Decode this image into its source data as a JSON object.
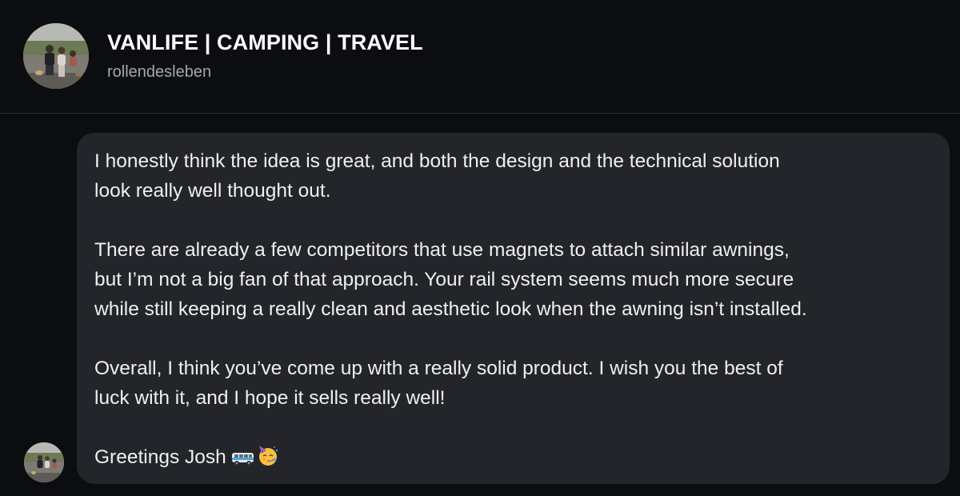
{
  "header": {
    "title": "VANLIFE | CAMPING | TRAVEL",
    "username": "rollendesleben"
  },
  "message": {
    "paragraphs": [
      [
        "I honestly think the idea is great, and both the design and the technical solution",
        "look really well thought out."
      ],
      [
        "There are already a few competitors that use magnets to attach similar awnings,",
        "but I’m not a big fan of that approach. Your rail system seems much more secure",
        "while still keeping a really clean and aesthetic look when the awning isn’t installed."
      ],
      [
        "Overall, I think you’ve come up with a really solid product. I wish you the best of",
        "luck with it, and I hope it sells really well!"
      ]
    ],
    "signoff": "Greetings Josh",
    "emojis": [
      "minibus-icon",
      "partying-face-icon"
    ]
  },
  "colors": {
    "background": "#0b0d11",
    "bubble": "#23252a",
    "text": "#eeeff1",
    "secondary_text": "#a4a7ad"
  }
}
